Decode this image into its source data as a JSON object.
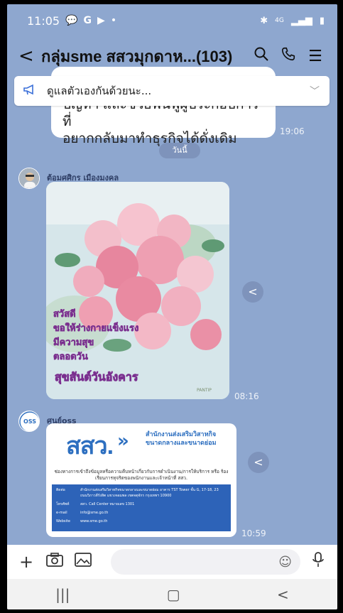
{
  "status": {
    "time": "11:05",
    "network": "4G",
    "left_icons": [
      "chat-bubble-icon",
      "google-icon",
      "youtube-icon"
    ],
    "dot": "•"
  },
  "header": {
    "title": "กลุ่มsme สสวมุกดาห...(103)"
  },
  "announcement": {
    "text": "ดูแลตัวเองกันด้วยนะ..."
  },
  "messages": [
    {
      "text_lines": [
        "ปัญหา และช่วยฟื้นฟูผู้ประกอบการที่",
        "อยากกลับมาทำธุรกิจได้ดั่งเดิม"
      ],
      "time": "19:06"
    },
    {
      "sender": "ต้อมศศิกร เมืองมงคล",
      "image_caption": "สุขสันต์วันอังคาร",
      "time": "08:16"
    },
    {
      "sender": "ศูนย์oss",
      "time": "10:59"
    }
  ],
  "date_separator": "วันนี้",
  "info_card": {
    "logo": "สสว.",
    "org_line1": "สำนักงานส่งเสริมวิสาหกิจ",
    "org_line2": "ขนาดกลางและขนาดย่อม",
    "desc": "ช่องทางการเข้าถึงข้อมูลหรือความคืบหน้าเกี่ยวกับการดำเนินงาน/การให้บริการ หรือ ร้องเรียนการทุจริตของพนักงานและเจ้าหน้าที่ สสว.",
    "rows": [
      {
        "k": "ติดต่อ",
        "v": "สำนักงานส่งเสริมวิสาหกิจขนาดกลางและขนาดย่อม อาคาร TST Tower ชั้น G, 17-18, 23 ถนนวิภาวดีรังสิต แขวงจอมพล เขตจตุจักร กรุงเทพฯ 10900"
      },
      {
        "k": "โทรศัพท์",
        "v": "สสว. Call Center หมายเลข 1301"
      },
      {
        "k": "e-mail",
        "v": "info@sme.go.th"
      },
      {
        "k": "Website",
        "v": "www.sme.go.th"
      }
    ]
  },
  "colors": {
    "chat_bg": "#8ea7cf",
    "accent": "#3a6fd8",
    "logo_blue": "#2d6fc0"
  }
}
